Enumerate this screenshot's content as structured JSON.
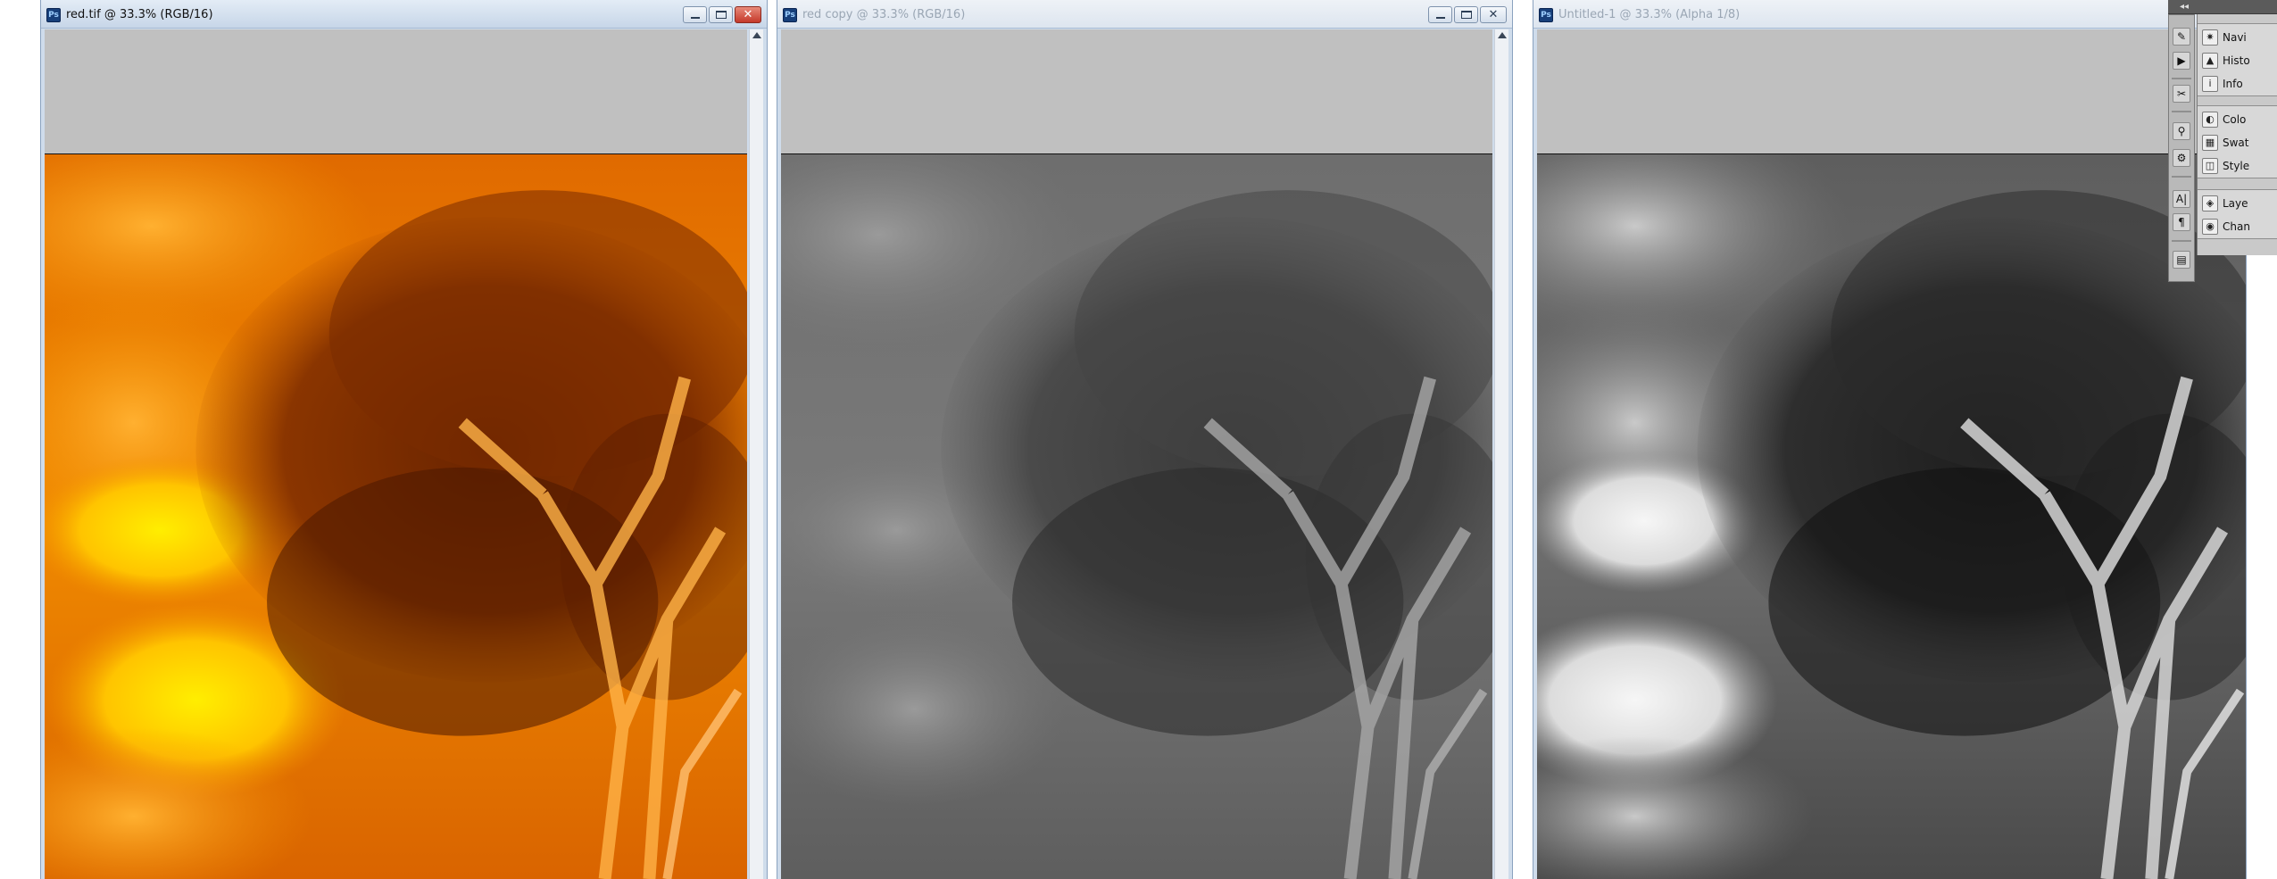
{
  "windows": [
    {
      "title": "red.tif @ 33.3% (RGB/16)",
      "state": "active",
      "image": "orange-tree-sunset"
    },
    {
      "title": "red copy @ 33.3% (RGB/16)",
      "state": "inactive",
      "image": "gray-tree"
    },
    {
      "title": "Untitled-1 @ 33.3% (Alpha 1/8)",
      "state": "inactive",
      "image": "high-contrast-gray-tree"
    }
  ],
  "window_controls": {
    "minimize_icon": "minimize-icon",
    "maximize_icon": "maximize-icon",
    "close_icon": "close-icon",
    "close_glyph": "✕"
  },
  "app_icon_text": "Ps",
  "dock": {
    "collapse_glyph": "◂◂",
    "tools": [
      "brush-preset-icon",
      "actions-icon",
      "tools-icon",
      "clone-source-icon",
      "tool-presets-icon",
      "character-icon",
      "paragraph-icon",
      "notes-icon"
    ],
    "tool_glyphs": [
      "✎",
      "▶",
      "✂",
      "⚲",
      "⚙",
      "A|",
      "¶",
      "▤"
    ],
    "panels": [
      {
        "label": "Navi",
        "icon": "navigator-icon",
        "glyph": "✷"
      },
      {
        "label": "Histo",
        "icon": "histogram-icon",
        "glyph": "▲"
      },
      {
        "label": "Info",
        "icon": "info-icon",
        "glyph": "i"
      },
      {
        "label": "Colo",
        "icon": "color-icon",
        "glyph": "◐"
      },
      {
        "label": "Swat",
        "icon": "swatches-icon",
        "glyph": "▦"
      },
      {
        "label": "Style",
        "icon": "styles-icon",
        "glyph": "◫"
      },
      {
        "label": "Laye",
        "icon": "layers-icon",
        "glyph": "◈"
      },
      {
        "label": "Chan",
        "icon": "channels-icon",
        "glyph": "◉"
      }
    ]
  },
  "colors": {
    "titlebar_active": "#cfdceb",
    "canvas_bg": "#c0c0c0",
    "close_red": "#c4392a",
    "orange_sky": "#f08a00",
    "orange_highlight": "#ffe000"
  }
}
